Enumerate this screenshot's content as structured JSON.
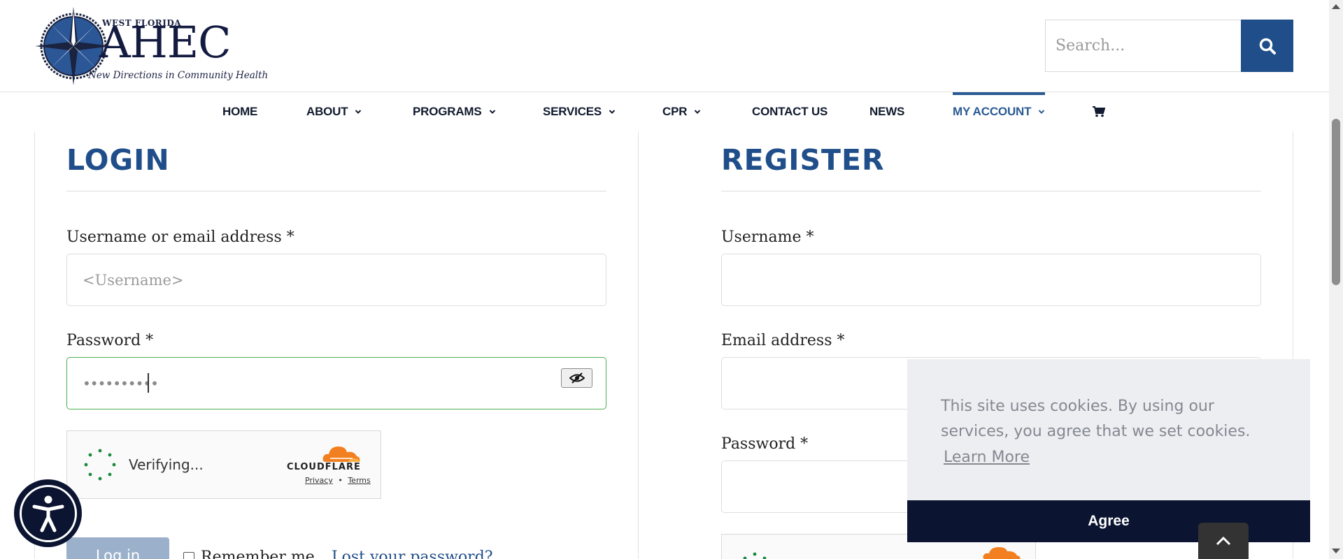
{
  "header": {
    "logo_top": "WEST FLORIDA",
    "logo_main": "AHEC",
    "logo_tagline": "New Directions in Community Health",
    "search_placeholder": "Search..."
  },
  "nav": {
    "items": [
      {
        "label": "HOME",
        "dropdown": false
      },
      {
        "label": "ABOUT",
        "dropdown": true
      },
      {
        "label": "PROGRAMS",
        "dropdown": true
      },
      {
        "label": "SERVICES",
        "dropdown": true
      },
      {
        "label": "CPR",
        "dropdown": true
      },
      {
        "label": "CONTACT US",
        "dropdown": false
      },
      {
        "label": "NEWS",
        "dropdown": false
      },
      {
        "label": "MY ACCOUNT",
        "dropdown": true,
        "active": true
      }
    ],
    "cart_icon": "shopping-cart-icon"
  },
  "login": {
    "title": "LOGIN",
    "username_label": "Username or email address *",
    "username_placeholder": "<Username>",
    "password_label": "Password *",
    "password_value": "••••••••••",
    "remember_label": "Remember me",
    "lost_password": "Lost your password?",
    "submit_label": "Log in"
  },
  "register": {
    "title": "REGISTER",
    "username_label": "Username *",
    "email_label": "Email address *",
    "password_label": "Password *"
  },
  "captcha": {
    "status": "Verifying...",
    "brand": "CLOUDFLARE",
    "privacy": "Privacy",
    "separator": "•",
    "terms": "Terms"
  },
  "cookie": {
    "message": "This site uses cookies. By using our services, you agree that we set cookies.",
    "learn_more": "Learn More",
    "agree": "Agree"
  },
  "colors": {
    "brand_blue": "#1f4e8a",
    "navy": "#0b1430",
    "focus_green": "#4caf50"
  }
}
